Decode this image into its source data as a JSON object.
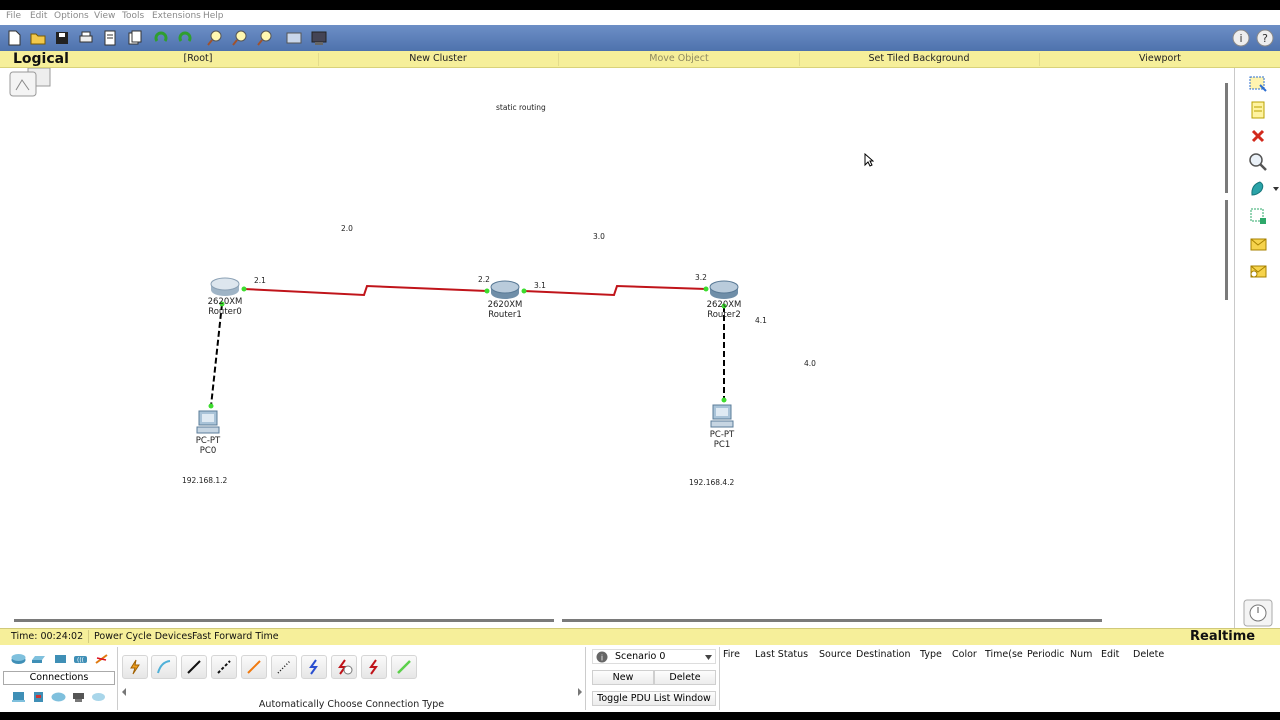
{
  "menu": [
    "File",
    "Edit",
    "Options",
    "View",
    "Tools",
    "Extensions",
    "Help"
  ],
  "header": {
    "title": "Logical",
    "root": "[Root]",
    "new_cluster": "New Cluster",
    "move_object": "Move Object",
    "set_tiled_background": "Set Tiled Background",
    "viewport": "Viewport"
  },
  "workspace": {
    "note_title": "static routing",
    "labels": {
      "net_2_0": "2.0",
      "net_3_0": "3.0",
      "net_4_0": "4.0",
      "if_2_1": "2.1",
      "if_2_2": "2.2",
      "if_3_1": "3.1",
      "if_3_2": "3.2",
      "if_4_1": "4.1",
      "pc0_ip": "192.168.1.2",
      "pc1_ip": "192.168.4.2"
    },
    "devices": {
      "router0": {
        "model": "2620XM",
        "name": "Router0"
      },
      "router1": {
        "model": "2620XM",
        "name": "Router1"
      },
      "router2": {
        "model": "2620XM",
        "name": "Router2"
      },
      "pc0": {
        "model": "PC-PT",
        "name": "PC0"
      },
      "pc1": {
        "model": "PC-PT",
        "name": "PC1"
      }
    }
  },
  "status": {
    "time": "Time: 00:24:02",
    "power_cycle": "Power Cycle Devices",
    "fast_forward": "Fast Forward Time",
    "mode": "Realtime"
  },
  "bottom": {
    "connections_label": "Connections",
    "auto_connection": "Automatically Choose Connection Type",
    "scenario": "Scenario 0",
    "new_button": "New",
    "delete_button": "Delete",
    "toggle_pdu": "Toggle PDU List Window",
    "pdu_columns": [
      "Fire",
      "Last Status",
      "Source",
      "Destination",
      "Type",
      "Color",
      "Time(se",
      "Periodic",
      "Num",
      "Edit",
      "Delete"
    ]
  }
}
